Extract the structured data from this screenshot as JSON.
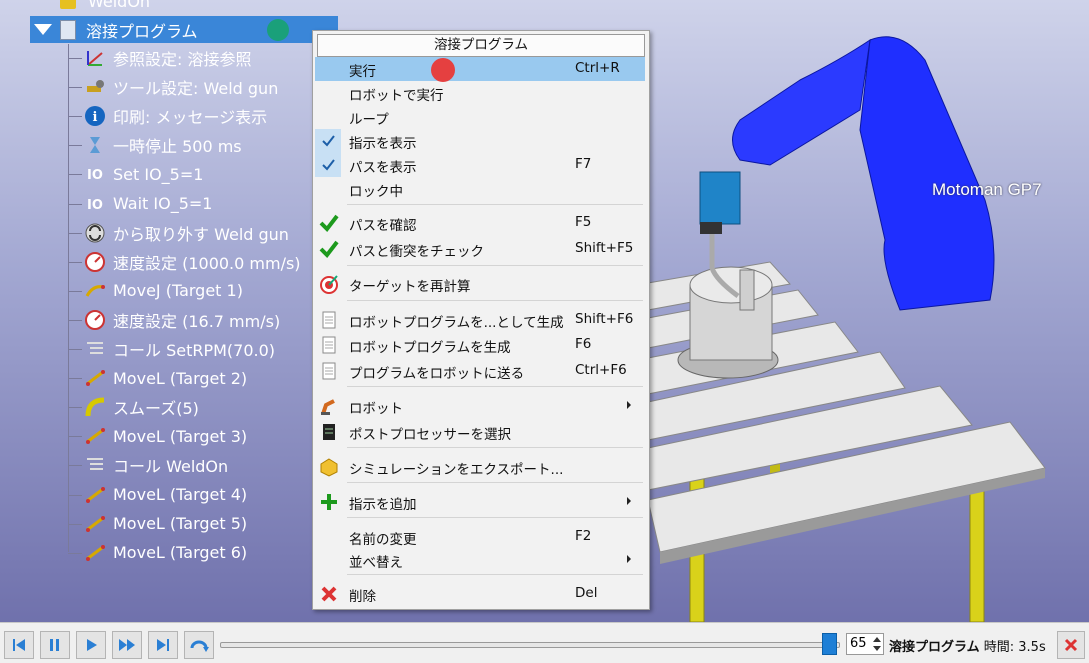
{
  "scene": {
    "robot_label": "Motoman GP7"
  },
  "tree": {
    "top_item": "WeldOn",
    "root": "溶接プログラム",
    "items": [
      {
        "label": "参照設定: 溶接参照",
        "icon": "reference-frame-icon"
      },
      {
        "label": "ツール設定: Weld gun",
        "icon": "tool-icon"
      },
      {
        "label": "印刷: メッセージ表示",
        "icon": "info-icon"
      },
      {
        "label": "一時停止 500 ms",
        "icon": "hourglass-icon"
      },
      {
        "label": "Set IO_5=1",
        "icon": "io-icon",
        "icon_text": "IO"
      },
      {
        "label": "Wait IO_5=1",
        "icon": "io-icon",
        "icon_text": "IO"
      },
      {
        "label": "から取り外す Weld gun",
        "icon": "detach-icon"
      },
      {
        "label": "速度設定 (1000.0 mm/s)",
        "icon": "speed-gauge-icon"
      },
      {
        "label": "MoveJ (Target 1)",
        "icon": "movej-icon"
      },
      {
        "label": "速度設定 (16.7 mm/s)",
        "icon": "speed-gauge-icon"
      },
      {
        "label": "コール SetRPM(70.0)",
        "icon": "program-call-icon"
      },
      {
        "label": "MoveL (Target 2)",
        "icon": "movel-icon"
      },
      {
        "label": "スムーズ(5)",
        "icon": "rounding-icon"
      },
      {
        "label": "MoveL (Target 3)",
        "icon": "movel-icon"
      },
      {
        "label": "コール WeldOn",
        "icon": "program-call-icon"
      },
      {
        "label": "MoveL (Target 4)",
        "icon": "movel-icon"
      },
      {
        "label": "MoveL (Target 5)",
        "icon": "movel-icon"
      },
      {
        "label": "MoveL (Target 6)",
        "icon": "movel-icon"
      }
    ]
  },
  "menu": {
    "title": "溶接プログラム",
    "items": [
      {
        "label": "実行",
        "shortcut": "Ctrl+R",
        "highlighted": true
      },
      {
        "label": "ロボットで実行",
        "shortcut": ""
      },
      {
        "label": "ループ",
        "shortcut": ""
      },
      {
        "label": "指示を表示",
        "shortcut": "",
        "checked": true
      },
      {
        "label": "パスを表示",
        "shortcut": "F7",
        "checked": true
      },
      {
        "label": "ロック中",
        "shortcut": ""
      },
      {
        "label": "パスを確認",
        "shortcut": "F5",
        "icon": "green-check-icon"
      },
      {
        "label": "パスと衝突をチェック",
        "shortcut": "Shift+F5",
        "icon": "green-check-icon"
      },
      {
        "label": "ターゲットを再計算",
        "shortcut": "",
        "icon": "target-icon"
      },
      {
        "label": "ロボットプログラムを...として生成",
        "shortcut": "Shift+F6",
        "icon": "document-icon"
      },
      {
        "label": "ロボットプログラムを生成",
        "shortcut": "F6",
        "icon": "document-icon"
      },
      {
        "label": "プログラムをロボットに送る",
        "shortcut": "Ctrl+F6",
        "icon": "document-icon"
      },
      {
        "label": "ロボット",
        "shortcut": "",
        "icon": "robot-icon",
        "submenu": true
      },
      {
        "label": "ポストプロセッサーを選択",
        "shortcut": "",
        "icon": "post-processor-icon"
      },
      {
        "label": "シミュレーションをエクスポート...",
        "shortcut": "",
        "icon": "export-icon"
      },
      {
        "label": "指示を追加",
        "shortcut": "",
        "icon": "plus-icon",
        "submenu": true
      },
      {
        "label": "名前の変更",
        "shortcut": "F2"
      },
      {
        "label": "並べ替え",
        "shortcut": "",
        "submenu": true
      },
      {
        "label": "削除",
        "shortcut": "Del",
        "icon": "red-x-icon"
      }
    ]
  },
  "toolbar": {
    "speed_value": "65",
    "status_program": "溶接プログラム",
    "status_time": "時間: 3.5s",
    "progress_fraction": 0.98
  },
  "colors": {
    "selection": "#3a86d8",
    "menu_highlight": "#99c9ef",
    "robot_blue": "#1f2fff"
  }
}
